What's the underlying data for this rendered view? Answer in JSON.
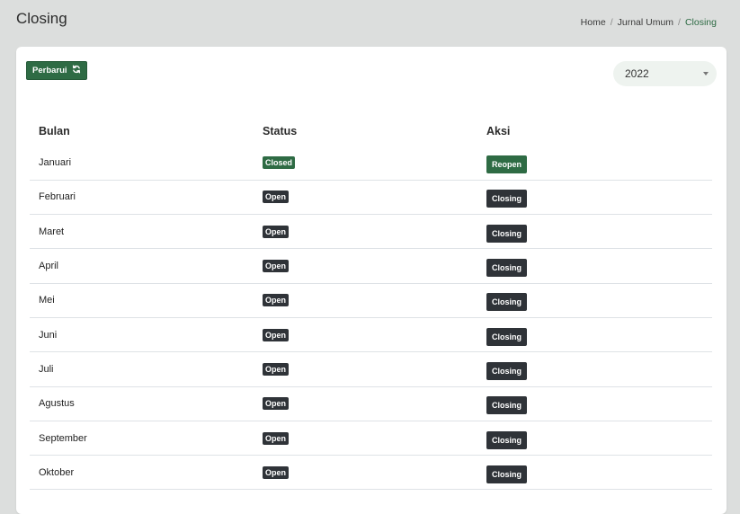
{
  "header": {
    "title": "Closing",
    "breadcrumb": [
      "Home",
      "Jurnal Umum",
      "Closing"
    ]
  },
  "toolbar": {
    "refresh_label": "Perbarui",
    "refresh_icon": "sync-icon",
    "year": "2022"
  },
  "table": {
    "headers": [
      "Bulan",
      "Status",
      "Aksi"
    ],
    "rows": [
      {
        "month": "Januari",
        "status": "Closed",
        "action": "Reopen"
      },
      {
        "month": "Februari",
        "status": "Open",
        "action": "Closing"
      },
      {
        "month": "Maret",
        "status": "Open",
        "action": "Closing"
      },
      {
        "month": "April",
        "status": "Open",
        "action": "Closing"
      },
      {
        "month": "Mei",
        "status": "Open",
        "action": "Closing"
      },
      {
        "month": "Juni",
        "status": "Open",
        "action": "Closing"
      },
      {
        "month": "Juli",
        "status": "Open",
        "action": "Closing"
      },
      {
        "month": "Agustus",
        "status": "Open",
        "action": "Closing"
      },
      {
        "month": "September",
        "status": "Open",
        "action": "Closing"
      },
      {
        "month": "Oktober",
        "status": "Open",
        "action": "Closing"
      }
    ]
  },
  "colors": {
    "primary_green": "#2e6b44",
    "dark": "#2f3338",
    "background": "#dcdedd"
  }
}
